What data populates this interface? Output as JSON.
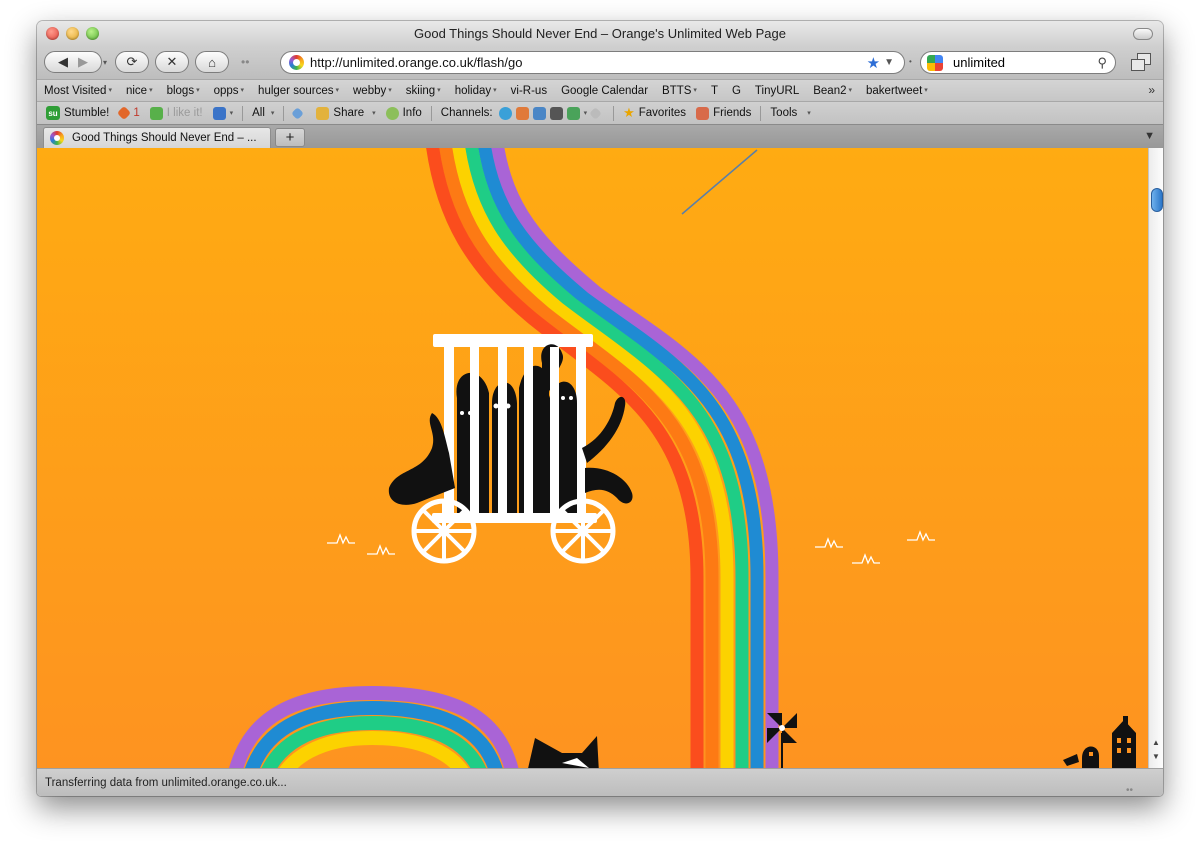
{
  "window": {
    "title": "Good Things Should Never End – Orange's Unlimited Web Page"
  },
  "navigation": {
    "url": "http://unlimited.orange.co.uk/flash/go",
    "search_value": "unlimited"
  },
  "bookmarks": [
    "Most Visited",
    "nice",
    "blogs",
    "opps",
    "hulger sources",
    "webby",
    "skiing",
    "holiday",
    "vi-R-us",
    "Google Calendar",
    "BTTS",
    "T",
    "G",
    "TinyURL",
    "Bean2",
    "bakertweet"
  ],
  "bookmarks_with_menu": [
    true,
    true,
    true,
    true,
    true,
    true,
    true,
    true,
    false,
    false,
    true,
    false,
    false,
    false,
    true,
    true
  ],
  "stumble": {
    "stumble_label": "Stumble!",
    "thumbs_count": "1",
    "like_label": "I like it!",
    "all_label": "All",
    "share_label": "Share",
    "info_label": "Info",
    "channels_label": "Channels:",
    "favorites_label": "Favorites",
    "friends_label": "Friends",
    "tools_label": "Tools"
  },
  "tabs": [
    {
      "title": "Good Things Should Never End – ..."
    }
  ],
  "status": {
    "text": "Transferring data from unlimited.orange.co.uk..."
  },
  "colors": {
    "page_bg_top": "#ffab12",
    "page_bg_bottom": "#fe9320",
    "rainbow": [
      "#fb4d1d",
      "#fd7a14",
      "#fcd200",
      "#1fcd86",
      "#1f8bd3",
      "#a964d6"
    ]
  }
}
